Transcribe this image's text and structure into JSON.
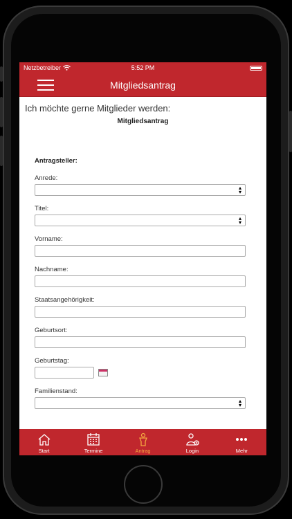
{
  "status": {
    "carrier": "Netzbetreiber",
    "time": "5:52 PM"
  },
  "nav": {
    "title": "Mitgliedsantrag"
  },
  "content": {
    "intro": "Ich möchte gerne Mitglieder werden:",
    "subtitle": "Mitgliedsantrag",
    "section": "Antragsteller:",
    "fields": {
      "anrede": {
        "label": "Anrede:",
        "value": ""
      },
      "titel": {
        "label": "Titel:",
        "value": ""
      },
      "vorname": {
        "label": "Vorname:",
        "value": ""
      },
      "nachname": {
        "label": "Nachname:",
        "value": ""
      },
      "staat": {
        "label": "Staatsangehörigkeit:",
        "value": ""
      },
      "geburtsort": {
        "label": "Geburtsort:",
        "value": ""
      },
      "geburtstag": {
        "label": "Geburtstag:",
        "value": ""
      },
      "familienstand": {
        "label": "Familienstand:",
        "value": ""
      }
    }
  },
  "tabs": [
    {
      "label": "Start",
      "icon": "home-icon"
    },
    {
      "label": "Termine",
      "icon": "calendar-icon"
    },
    {
      "label": "Antrag",
      "icon": "person-icon",
      "active": true
    },
    {
      "label": "Login",
      "icon": "user-add-icon"
    },
    {
      "label": "Mehr",
      "icon": "more-icon"
    }
  ],
  "colors": {
    "accent": "#c0272d",
    "active_tab": "#f3a640"
  }
}
